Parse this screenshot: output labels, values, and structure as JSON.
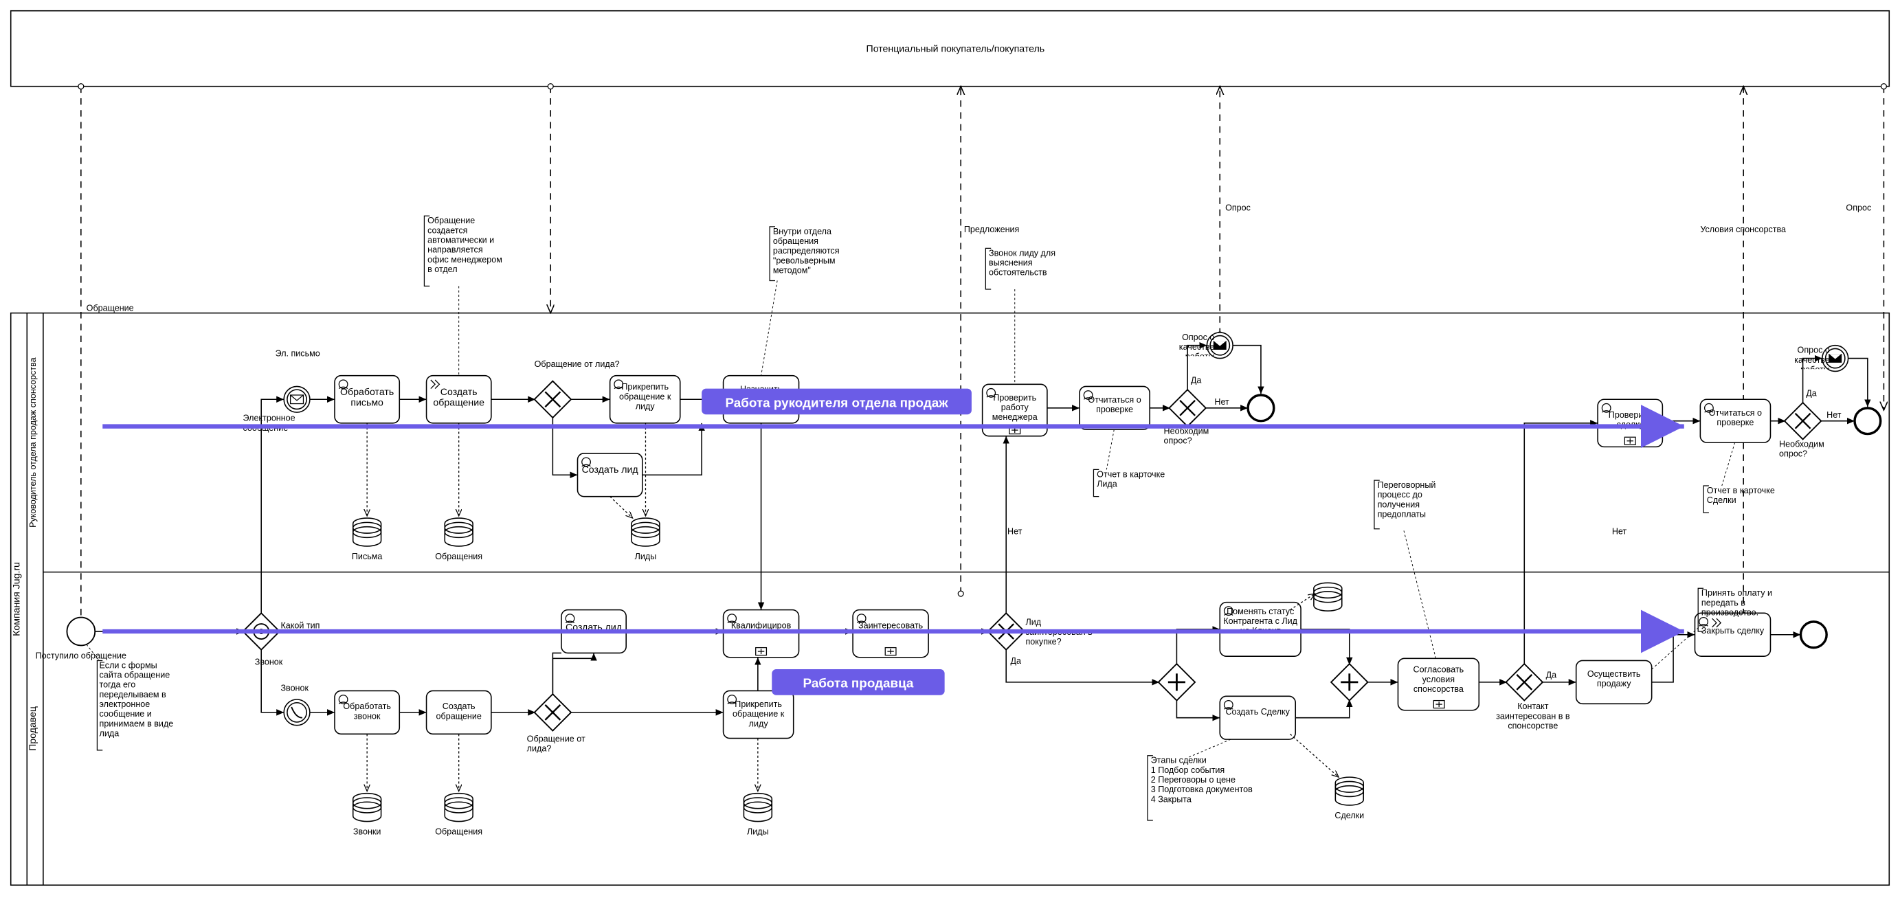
{
  "pools": {
    "top": "Потенциальный покупатель/покупатель",
    "left_outer": "Компания Jug.ru",
    "lane_head": "Руководитель отдела продаж спонсорства",
    "lane_seller": "Продавец"
  },
  "highlights": {
    "head": "Работа рукодителя отдела продаж",
    "seller": "Работа  продавца"
  },
  "tasks": {
    "t_process_letter": "Обработать письмо",
    "t_create_appeal_h": "Создать обращение",
    "t_attach_lead_h": "Прикрепить обращение к лиду",
    "t_create_lead_h": "Создать лид",
    "t_assign_resp": "Назначить ответственного",
    "t_check_mgr": "Проверить работу менеджера",
    "t_report_check_h": "Отчитаться о проверке",
    "t_check_deal": "Проверить сделку",
    "t_report_check_h2": "Отчитаться о проверке",
    "t_create_lead_s": "Создать лид",
    "t_qualify": "Квалифициров",
    "t_interest": "Заинтересовать",
    "t_change_status": "Поменять статус Контрагента с Лид на Клиент",
    "t_create_deal": "Создать Сделку",
    "t_agree_sponsor": "Согласовать условия спонсорства",
    "t_make_sale": "Осуществить продажу",
    "t_close_deal": "Закрыть сделку",
    "t_process_call": "Обработать звонок",
    "t_create_appeal_s": "Создать обращение",
    "t_attach_lead_s": "Прикрепить обращение к лиду"
  },
  "events": {
    "start": "Поступило обращение",
    "email_label": "Эл. письмо",
    "email_catch": "Электронное сообщение",
    "call_label": "Звонок",
    "survey_h": "Опрос о качестве работы",
    "survey_h2": "Опрос о качестве работы"
  },
  "gateways": {
    "g_type": "Какой тип",
    "g_from_lead_h": "Обращение от лида?",
    "g_from_lead_s": "Обращение от лида?",
    "g_need_poll": "Необходим опрос?",
    "g_need_poll2": "Необходим опрос?",
    "g_interested": "Лид заинтересован в покупке?",
    "g_contact_interested": "Контакт заинтересован в в спонсорстве",
    "g_call_branch": "Звонок"
  },
  "yesno": {
    "yes": "Да",
    "no": "Нет"
  },
  "data": {
    "d_letters": "Письма",
    "d_appeals_h": "Обращения",
    "d_leads_h": "Лиды",
    "d_calls": "Звонки",
    "d_appeals_s": "Обращения",
    "d_leads_s": "Лиды",
    "d_deals": "Сделки",
    "d_clients": ""
  },
  "annotations": {
    "a_form": "Если с формы сайта обращение тогда его переделываем в электронное сообщение и принимаем в виде лида",
    "a_auto": "Обращение создается автоматически и направляется офис менеджером в отдел",
    "a_revolver": "Внутри отдела обращения распределяются \"револьверным методом\"",
    "a_call_lead": "Звонок лиду для выяснения обстоятельств",
    "a_lead_card": "Отчет в карточке Лида",
    "a_deal_card": "Отчет в карточке Сделки",
    "a_stages": "Этапы сделки\n1 Подбор события\n2 Переговоры о цене\n3 Подготовка документов\n4 Закрыта",
    "a_negotiation": "Переговорный процесс до получения предоплаты",
    "a_accept": "Принять оплату и передать в производство."
  },
  "msg_labels": {
    "appeal": "Обращение",
    "offers": "Предложения",
    "poll": "Опрос",
    "poll2": "Опрос",
    "terms": "Условия спонсорства"
  }
}
